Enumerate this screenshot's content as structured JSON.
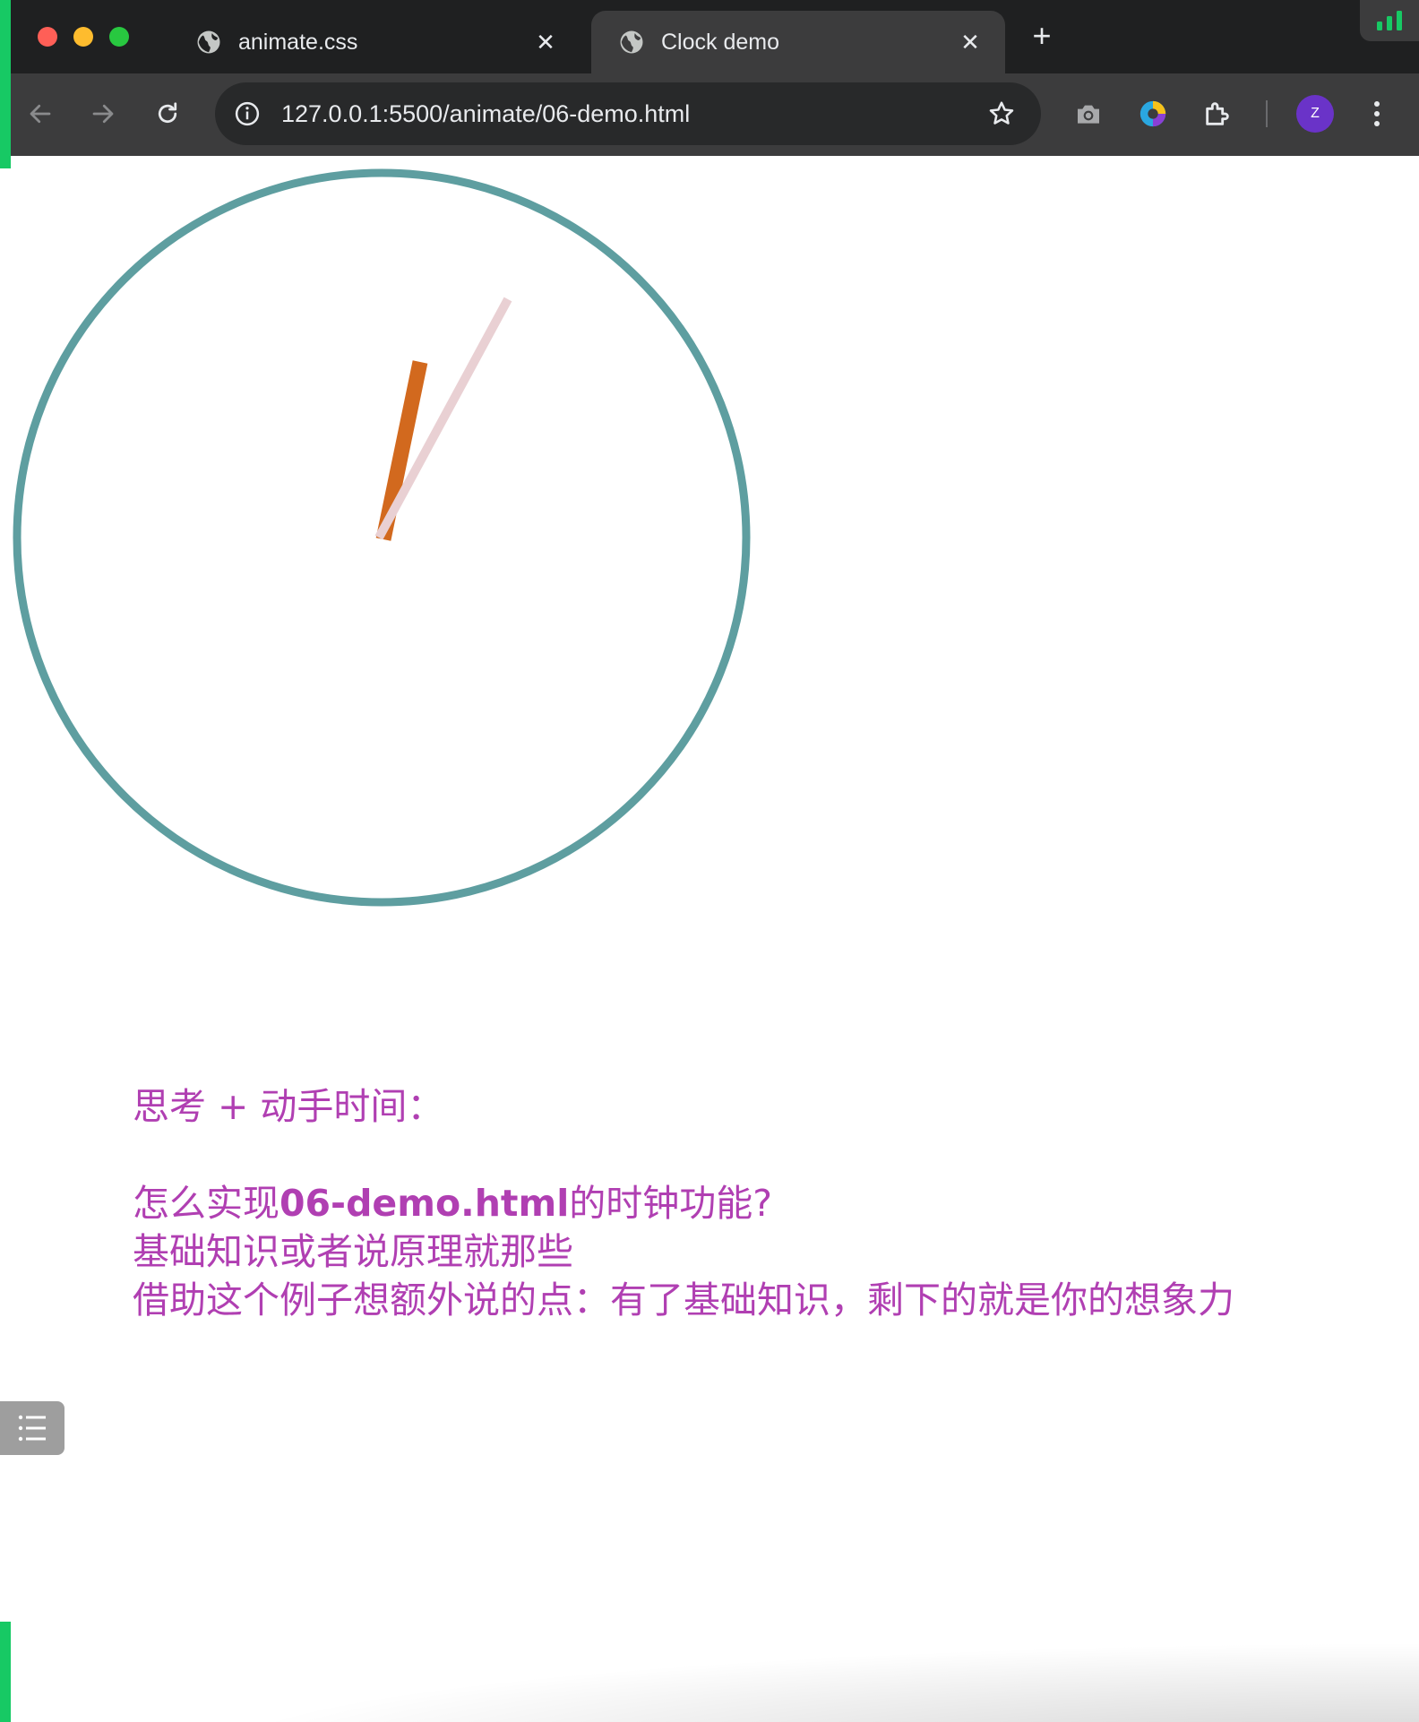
{
  "browser": {
    "tabs": [
      {
        "title": "animate.css",
        "active": false,
        "icon": "globe-icon"
      },
      {
        "title": "Clock demo",
        "active": true,
        "icon": "globe-icon"
      }
    ],
    "new_tab_label": "+",
    "url": "127.0.0.1:5500/animate/06-demo.html",
    "profile_initial": "Z",
    "toolbar_icons": [
      "back-icon",
      "forward-icon",
      "reload-icon",
      "site-info-icon",
      "bookmark-star-icon",
      "camera-icon",
      "extension-colorful-icon",
      "puzzle-icon",
      "more-icon"
    ]
  },
  "page": {
    "line1": "思考 + 动手时间：",
    "line2_prefix": "怎么实现",
    "line2_bold": "06-demo.html",
    "line2_suffix": "的时钟功能?",
    "line3": "基础知识或者说原理就那些",
    "line4": "借助这个例子想额外说的点：有了基础知识，剩下的就是你的想象力"
  },
  "colors": {
    "clock_face": "#5e9ea0",
    "hour_hand": "#d2691e",
    "second_hand": "#e9d0d3",
    "text": "#b03fb2",
    "accent_strip": "#17c964"
  }
}
